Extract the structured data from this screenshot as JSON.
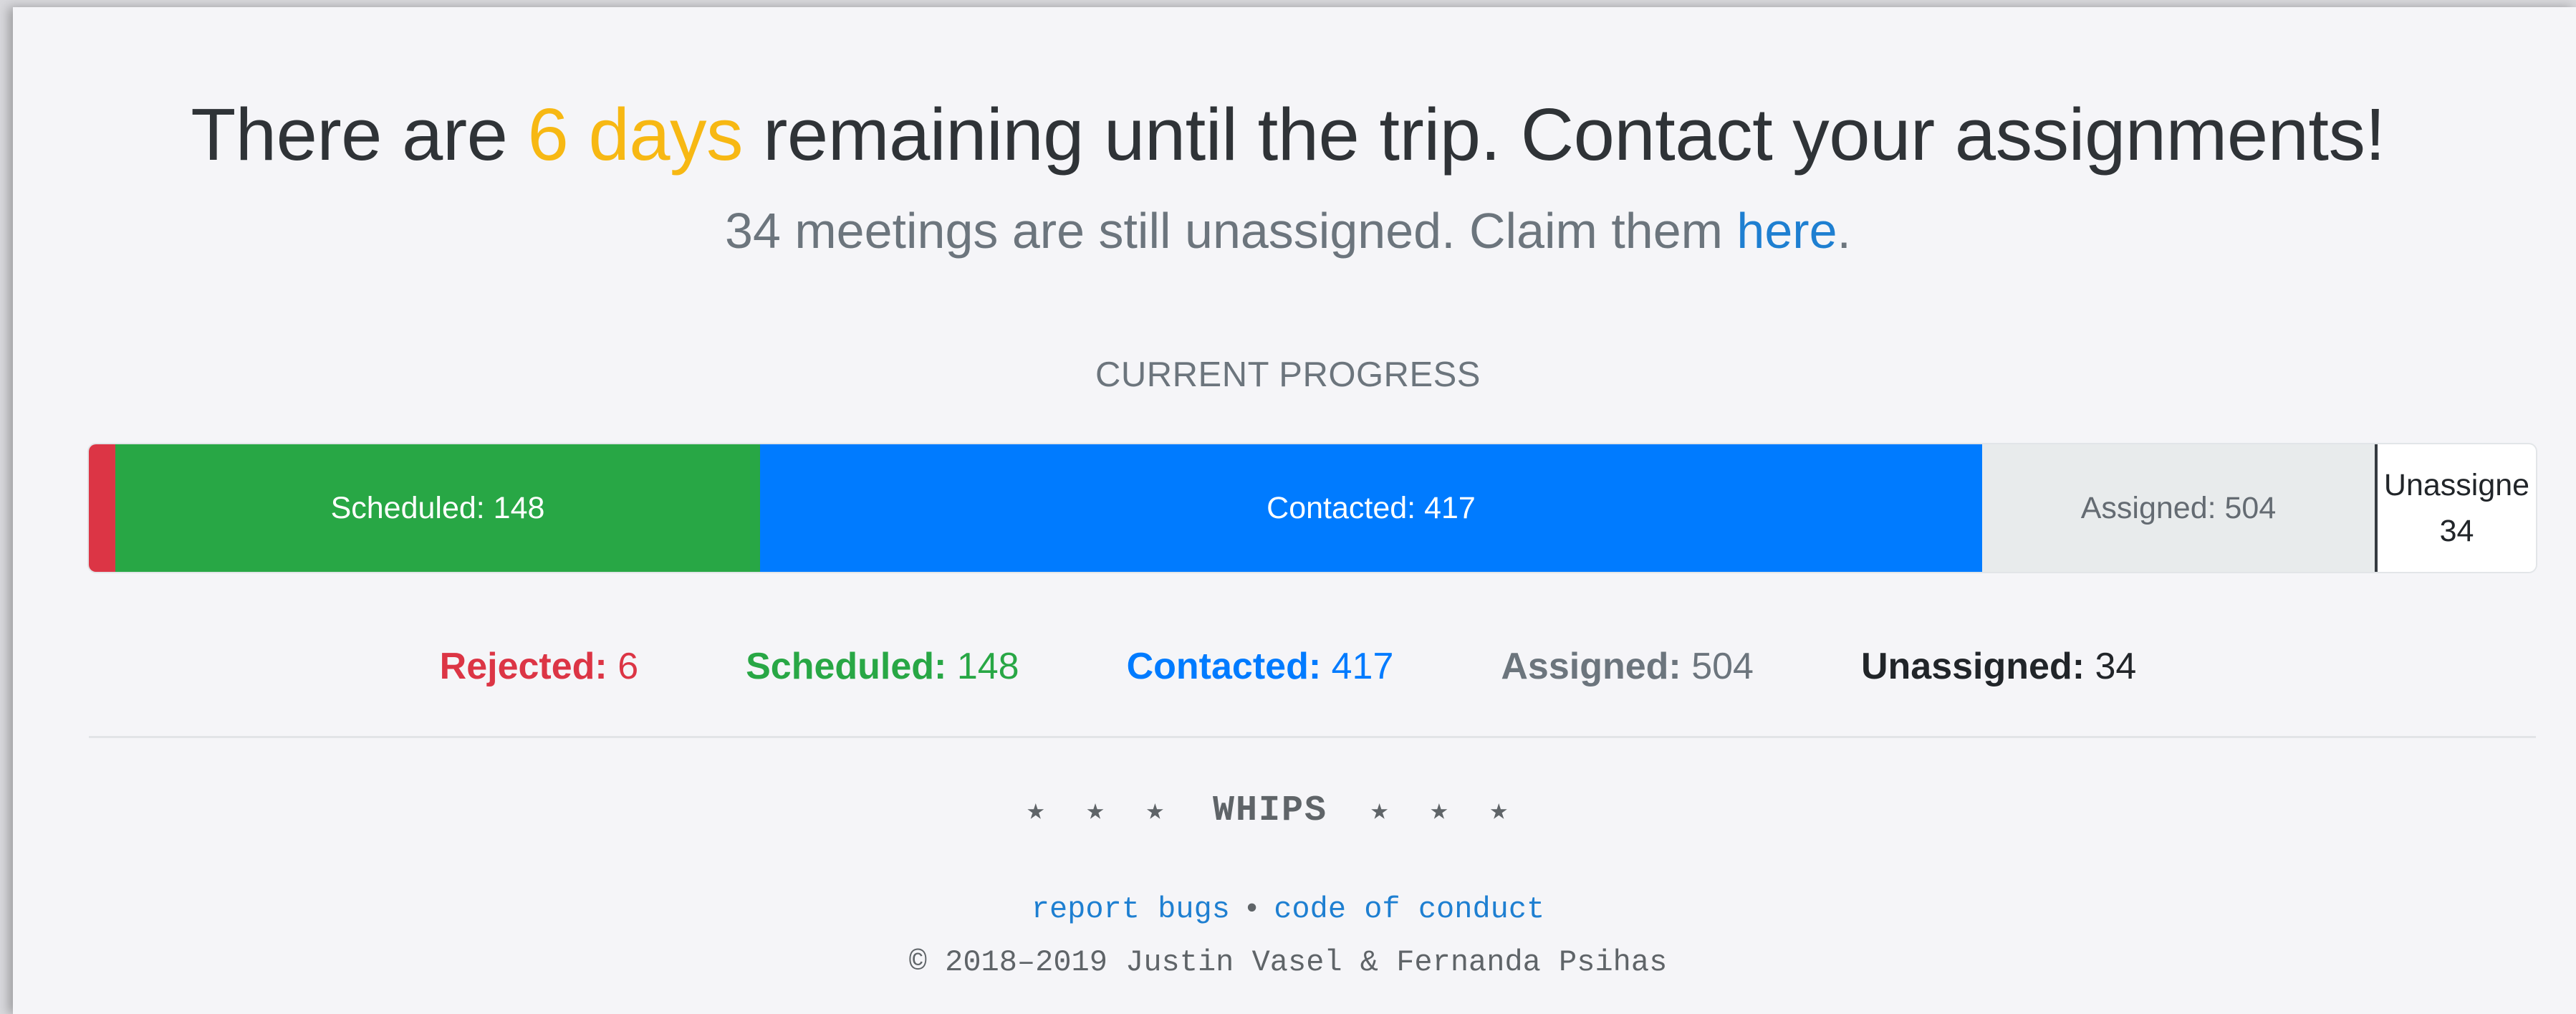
{
  "headline": {
    "prefix": "There are ",
    "days": "6 days",
    "suffix": " remaining until the trip. Contact your assignments!"
  },
  "subline": {
    "text": "34 meetings are still unassigned. Claim them ",
    "link": "here",
    "end": "."
  },
  "progress": {
    "heading": "CURRENT PROGRESS",
    "segments": {
      "rejected": {
        "label": "",
        "value": 6
      },
      "scheduled": {
        "label": "Scheduled: 148",
        "value": 148
      },
      "contacted": {
        "label": "Contacted: 417",
        "value": 417
      },
      "assigned": {
        "label": "Assigned: 504",
        "value": 504
      },
      "unassigned": {
        "label_line1": "Unassigne",
        "label_line2": "34",
        "value": 34
      }
    }
  },
  "legend": {
    "rejected": {
      "label": "Rejected:",
      "value": "6"
    },
    "scheduled": {
      "label": "Scheduled:",
      "value": "148"
    },
    "contacted": {
      "label": "Contacted:",
      "value": "417"
    },
    "assigned": {
      "label": "Assigned:",
      "value": "504"
    },
    "unassigned": {
      "label": "Unassigned:",
      "value": "34"
    }
  },
  "footer": {
    "stars_left": "★★★",
    "brand": "WHIPS",
    "stars_right": "★★★",
    "report_bugs": "report bugs",
    "separator": "•",
    "code_of_conduct": "code of conduct",
    "copyright": "© 2018–2019 Justin Vasel & Fernanda Psihas"
  },
  "colors": {
    "days_accent": "#f7b813",
    "link": "#1e7fd1",
    "rejected": "#dc3545",
    "scheduled": "#28a745",
    "contacted": "#007bff",
    "assigned": "#6c757d",
    "unassigned": "#212529"
  }
}
